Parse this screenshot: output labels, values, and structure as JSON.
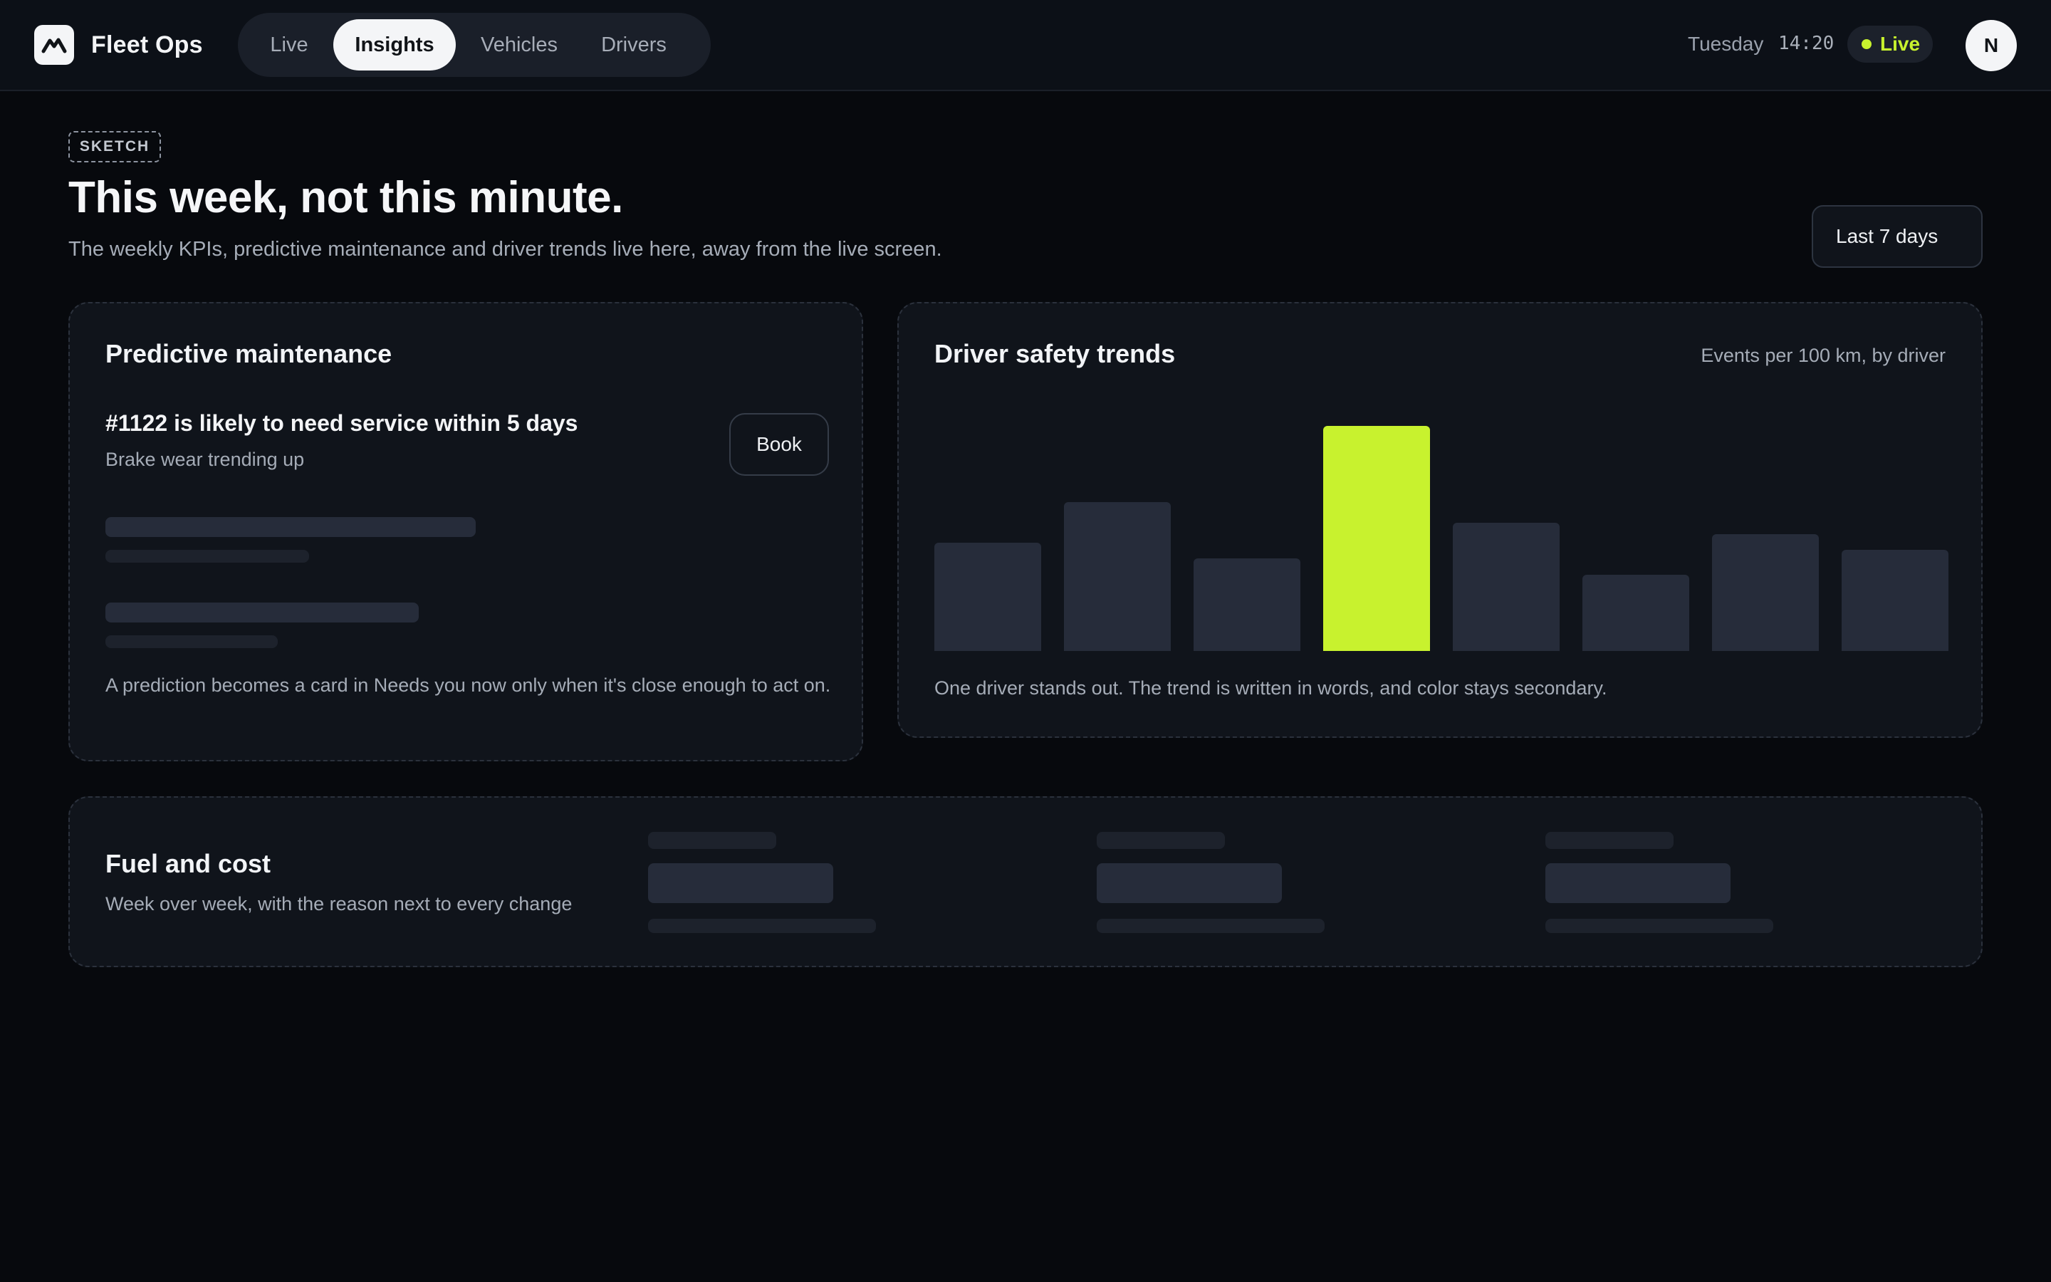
{
  "app": {
    "name": "Fleet Ops",
    "logo_icon": "mountain-logo-icon"
  },
  "nav": {
    "items": [
      {
        "label": "Live",
        "active": false
      },
      {
        "label": "Insights",
        "active": true
      },
      {
        "label": "Vehicles",
        "active": false
      },
      {
        "label": "Drivers",
        "active": false
      }
    ]
  },
  "status": {
    "day": "Tuesday",
    "time": "14:20",
    "live_label": "Live",
    "live_color": "#c8f22e",
    "avatar_initial": "N"
  },
  "header": {
    "badge": "SKETCH",
    "title": "This week, not this minute.",
    "subtitle": "The weekly KPIs, predictive maintenance and driver trends live here, away from the live screen.",
    "range_button": "Last 7 days"
  },
  "maintenance": {
    "title": "Predictive maintenance",
    "item_title": "#1122 is likely to need service within 5 days",
    "item_subtitle": "Brake wear trending up",
    "book_label": "Book",
    "note": "A prediction becomes a card in Needs you now only when it's close enough to act on."
  },
  "safety": {
    "title": "Driver safety trends",
    "caption": "Events per 100 km, by driver",
    "note": "One driver stands out. The trend is written in words, and color stays secondary.",
    "highlight_color": "#c8f22e",
    "bar_color": "#262c3a"
  },
  "fuel": {
    "title": "Fuel and cost",
    "subtitle": "Week over week, with the reason next to every change"
  },
  "chart_data": {
    "type": "bar",
    "title": "Driver safety trends",
    "subtitle": "Events per 100 km, by driver",
    "categories": [
      "",
      "",
      "",
      "",
      "",
      "",
      "",
      ""
    ],
    "values": [
      0.48,
      0.66,
      0.41,
      1.0,
      0.57,
      0.34,
      0.52,
      0.45
    ],
    "highlight_index": 3,
    "ylim": [
      0,
      1
    ],
    "grid": false,
    "legend": "none"
  }
}
